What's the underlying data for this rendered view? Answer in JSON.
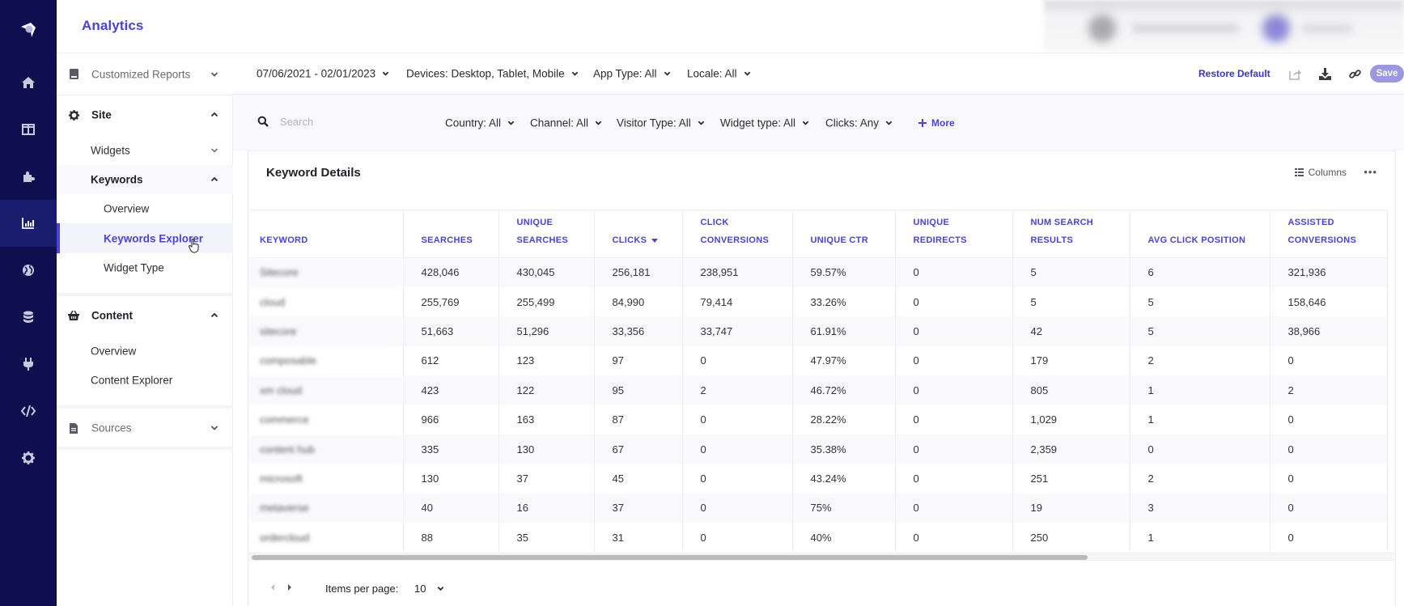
{
  "app": {
    "title": "Analytics",
    "brand_color": "#4b43d6",
    "rail_color": "#0f0f50"
  },
  "rail": {
    "items": [
      {
        "icon": "logo-icon"
      },
      {
        "icon": "home-icon"
      },
      {
        "icon": "layout-icon"
      },
      {
        "icon": "puzzle-icon"
      },
      {
        "icon": "chart-icon",
        "active": true
      },
      {
        "icon": "globe-icon"
      },
      {
        "icon": "database-icon"
      },
      {
        "icon": "plug-icon"
      },
      {
        "icon": "code-icon"
      },
      {
        "icon": "gear-icon"
      }
    ]
  },
  "subnav": {
    "customized_reports": "Customized Reports",
    "site": "Site",
    "widgets": "Widgets",
    "keywords": "Keywords",
    "keywords_overview": "Overview",
    "keywords_explorer": "Keywords Explorer",
    "widget_type": "Widget Type",
    "content": "Content",
    "content_overview": "Overview",
    "content_explorer": "Content Explorer",
    "sources": "Sources"
  },
  "toolbar": {
    "date_range": "07/06/2021 - 02/01/2023",
    "devices": "Devices: Desktop, Tablet, Mobile",
    "app_type": "App Type: All",
    "locale": "Locale: All",
    "restore_default": "Restore Default",
    "save": "Save"
  },
  "filters": {
    "search_placeholder": "Search",
    "search_value": "",
    "country": "Country: All",
    "channel": "Channel: All",
    "visitor_type": "Visitor Type: All",
    "widget_type": "Widget type: All",
    "clicks": "Clicks: Any",
    "more": "More"
  },
  "card": {
    "title": "Keyword Details",
    "columns_label": "Columns",
    "more_label": "•••"
  },
  "table": {
    "sorted_column": "CLICKS",
    "sort_direction": "desc",
    "headers": [
      {
        "line1": "",
        "line2": "KEYWORD"
      },
      {
        "line1": "",
        "line2": "SEARCHES"
      },
      {
        "line1": "UNIQUE",
        "line2": "SEARCHES"
      },
      {
        "line1": "",
        "line2": "CLICKS"
      },
      {
        "line1": "CLICK",
        "line2": "CONVERSIONS"
      },
      {
        "line1": "",
        "line2": "UNIQUE CTR"
      },
      {
        "line1": "UNIQUE",
        "line2": "REDIRECTS"
      },
      {
        "line1": "NUM SEARCH",
        "line2": "RESULTS"
      },
      {
        "line1": "",
        "line2": "AVG CLICK POSITION"
      },
      {
        "line1": "ASSISTED",
        "line2": "CONVERSIONS"
      }
    ],
    "rows": [
      [
        "Sitecore",
        "428,046",
        "430,045",
        "256,181",
        "238,951",
        "59.57%",
        "0",
        "5",
        "6",
        "321,936"
      ],
      [
        "cloud",
        "255,769",
        "255,499",
        "84,990",
        "79,414",
        "33.26%",
        "0",
        "5",
        "5",
        "158,646"
      ],
      [
        "sitecore",
        "51,663",
        "51,296",
        "33,356",
        "33,747",
        "61.91%",
        "0",
        "42",
        "5",
        "38,966"
      ],
      [
        "composable",
        "612",
        "123",
        "97",
        "0",
        "47.97%",
        "0",
        "179",
        "2",
        "0"
      ],
      [
        "xm cloud",
        "423",
        "122",
        "95",
        "2",
        "46.72%",
        "0",
        "805",
        "1",
        "2"
      ],
      [
        "commerce",
        "966",
        "163",
        "87",
        "0",
        "28.22%",
        "0",
        "1,029",
        "1",
        "0"
      ],
      [
        "content hub",
        "335",
        "130",
        "67",
        "0",
        "35.38%",
        "0",
        "2,359",
        "0",
        "0"
      ],
      [
        "microsoft",
        "130",
        "37",
        "45",
        "0",
        "43.24%",
        "0",
        "251",
        "2",
        "0"
      ],
      [
        "metaverse",
        "40",
        "16",
        "37",
        "0",
        "75%",
        "0",
        "19",
        "3",
        "0"
      ],
      [
        "ordercloud",
        "88",
        "35",
        "31",
        "0",
        "40%",
        "0",
        "250",
        "1",
        "0"
      ]
    ]
  },
  "pager": {
    "items_per_page_label": "Items per page:",
    "items_per_page_value": "10"
  }
}
